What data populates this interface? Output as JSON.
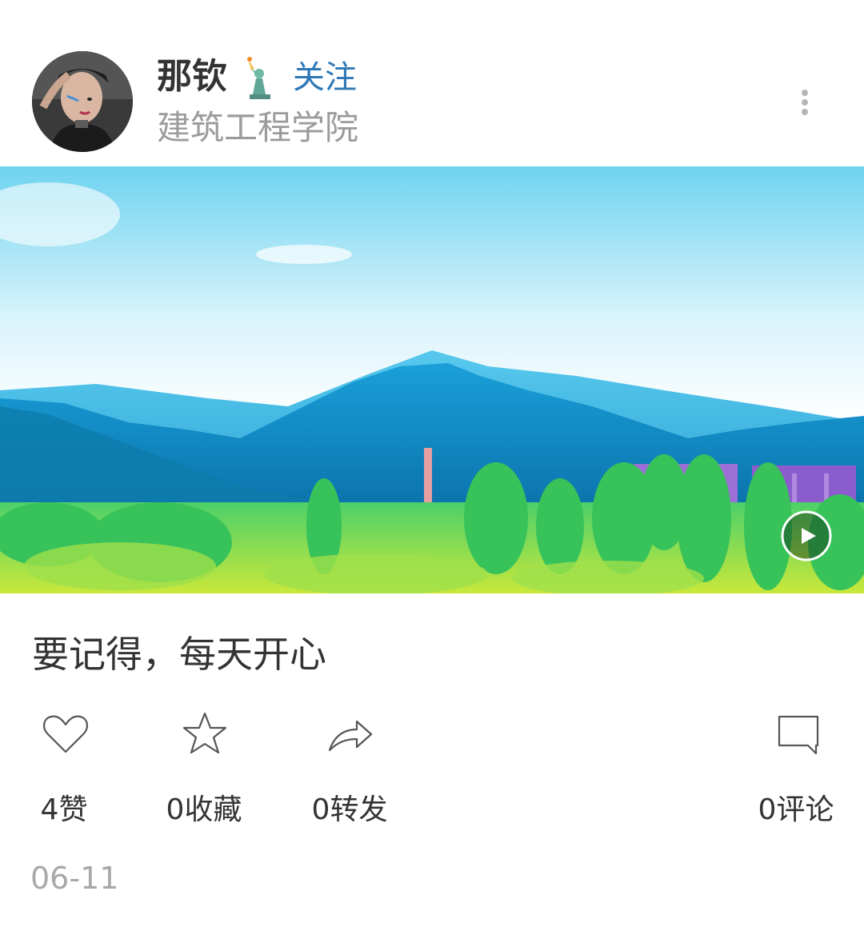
{
  "author": {
    "name": "那钦",
    "badge_icon": "statue-of-liberty-emoji",
    "follow_label": "关注",
    "school": "建筑工程学院"
  },
  "post": {
    "caption": "要记得，每天开心",
    "date": "06-11",
    "media_type": "video"
  },
  "actions": {
    "like_label": "4赞",
    "favorite_label": "0收藏",
    "share_label": "0转发",
    "comment_label": "0评论"
  },
  "colors": {
    "accent": "#2e78b7",
    "text": "#333333",
    "muted": "#9b9b9b"
  }
}
